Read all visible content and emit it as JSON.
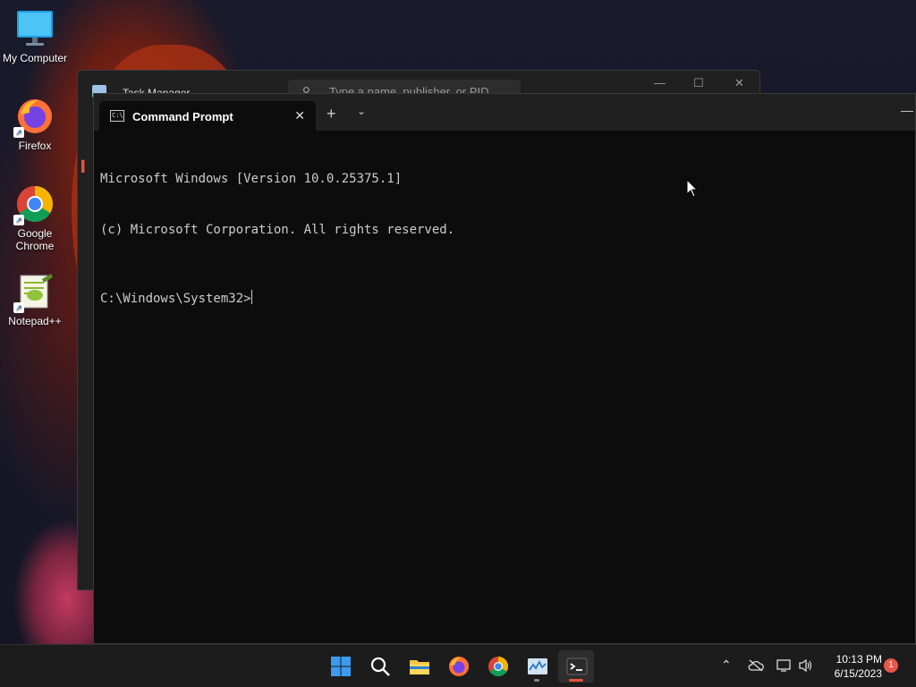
{
  "desktop": {
    "icons": [
      {
        "label": "My Computer",
        "icon": "monitor-icon"
      },
      {
        "label": "Firefox",
        "icon": "firefox-icon"
      },
      {
        "label": "Google Chrome",
        "icon": "chrome-icon"
      },
      {
        "label": "Notepad++",
        "icon": "notepadpp-icon"
      }
    ]
  },
  "task_manager": {
    "title": "Task Manager",
    "search_placeholder": "Type a name, publisher, or PID"
  },
  "terminal": {
    "tab_title": "Command Prompt",
    "new_tab_symbol": "+",
    "lines": [
      "Microsoft Windows [Version 10.0.25375.1]",
      "(c) Microsoft Corporation. All rights reserved."
    ],
    "prompt": "C:\\Windows\\System32>"
  },
  "taskbar": {
    "apps": [
      {
        "name": "start",
        "icon": "windows-start-icon"
      },
      {
        "name": "search",
        "icon": "search-icon"
      },
      {
        "name": "file-explorer",
        "icon": "folder-icon"
      },
      {
        "name": "firefox",
        "icon": "firefox-icon",
        "running": false
      },
      {
        "name": "chrome",
        "icon": "chrome-icon",
        "running": false
      },
      {
        "name": "task-manager",
        "icon": "task-manager-icon",
        "running": true
      },
      {
        "name": "terminal",
        "icon": "terminal-icon",
        "running": true,
        "active": true
      }
    ],
    "clock": {
      "time": "10:13 PM",
      "date": "6/15/2023"
    },
    "notification_count": "1"
  },
  "colors": {
    "accent": "#e6543d",
    "terminal_bg": "#0c0c0c",
    "terminal_text": "#cccccc",
    "taskbar_bg": "#1c1c1c"
  }
}
